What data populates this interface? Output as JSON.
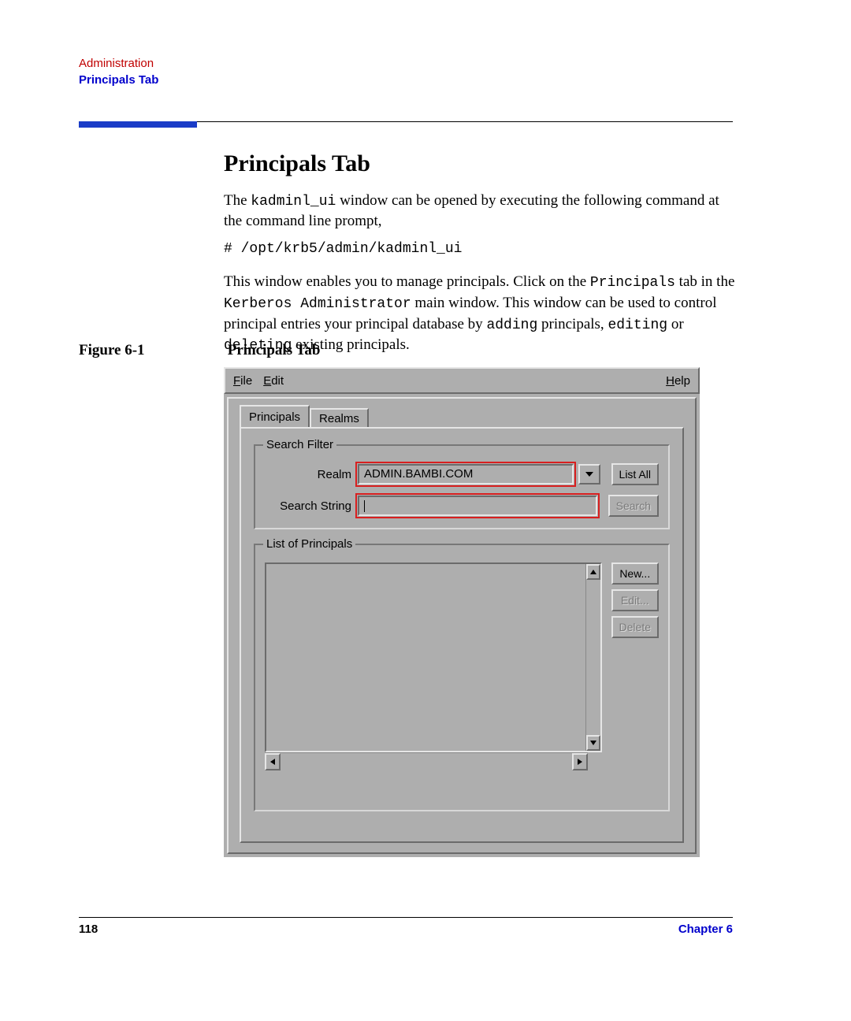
{
  "header": {
    "chapter_name": "Administration",
    "section_name": "Principals Tab"
  },
  "body": {
    "title": "Principals Tab",
    "para1_pre": "The ",
    "para1_code": "kadminl_ui",
    "para1_post": " window can be opened by executing the following command at the command line prompt,",
    "command": "# /opt/krb5/admin/kadminl_ui",
    "para2_pre": "This window enables you to manage principals. Click on the ",
    "para2_c1": "Principals",
    "para2_mid1": " tab in the ",
    "para2_c2": "Kerberos Administrator",
    "para2_mid2": " main window. This window can be used to control principal entries your principal database by ",
    "para2_c3": "adding",
    "para2_mid3": " principals, ",
    "para2_c4": "editing",
    "para2_mid4": " or ",
    "para2_c5": "deleting",
    "para2_post": " existing principals."
  },
  "figure": {
    "label": "Figure 6-1",
    "caption": "Principals Tab"
  },
  "app": {
    "menu": {
      "file": "File",
      "edit": "Edit",
      "help": "Help"
    },
    "tabs": {
      "principals": "Principals",
      "realms": "Realms"
    },
    "search_filter": {
      "title": "Search Filter",
      "realm_label": "Realm",
      "realm_value": "ADMIN.BAMBI.COM",
      "search_string_label": "Search String",
      "search_string_value": ""
    },
    "buttons": {
      "list_all": "List All",
      "search": "Search",
      "new": "New...",
      "edit": "Edit...",
      "delete": "Delete"
    },
    "list": {
      "title": "List of Principals"
    }
  },
  "footer": {
    "page": "118",
    "chapter": "Chapter 6"
  }
}
